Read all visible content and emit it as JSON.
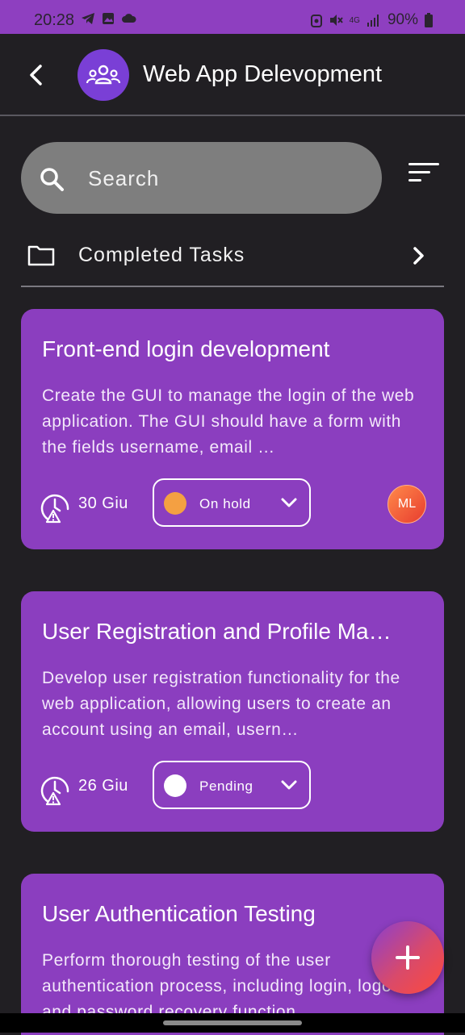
{
  "status_bar": {
    "time": "20:28",
    "network": "4G",
    "battery": "90%"
  },
  "header": {
    "title": "Web App Delevopment",
    "back_icon": "back-arrow-icon",
    "avatar_icon": "group-icon",
    "avatar_color": "#7a3fd6"
  },
  "search": {
    "placeholder": "Search"
  },
  "completed_section": {
    "label": "Completed Tasks"
  },
  "tasks": [
    {
      "title": "Front-end login development",
      "description": "Create the GUI to manage the login of the web application. The GUI should have a form with the fields username, email …",
      "due": "30 Giu",
      "status": "On hold",
      "status_color": "#f4a042",
      "assignee": "ML"
    },
    {
      "title": "User Registration and Profile Ma…",
      "description": "Develop user registration functionality for the web application, allowing users to create an account using an email, usern…",
      "due": "26 Giu",
      "status": "Pending",
      "status_color": "#ffffff"
    },
    {
      "title": "User Authentication Testing",
      "description": "Perform thorough testing of the user authentication process, including login, logout, and password recovery function"
    }
  ],
  "colors": {
    "background": "#211f23",
    "card": "#8b3ebf",
    "status_bar": "#8e3fc0"
  }
}
